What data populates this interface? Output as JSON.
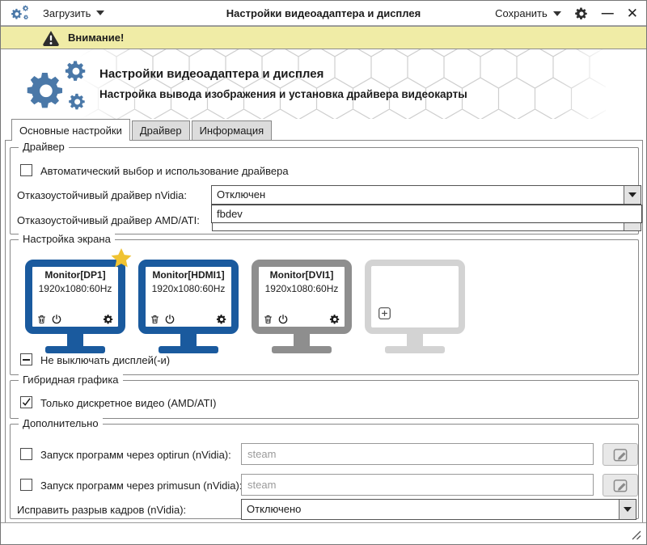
{
  "titlebar": {
    "load_label": "Загрузить",
    "title": "Настройки видеоадаптера и дисплея",
    "save_label": "Сохранить"
  },
  "banner": {
    "text": "Внимание!"
  },
  "header": {
    "title": "Настройки видеоадаптера и дисплея",
    "subtitle": "Настройка вывода изображения и установка драйвера видеокарты"
  },
  "tabs": [
    {
      "label": "Основные настройки",
      "active": true
    },
    {
      "label": "Драйвер",
      "active": false
    },
    {
      "label": "Информация",
      "active": false
    }
  ],
  "driver_group": {
    "title": "Драйвер",
    "auto_checkbox_label": "Автоматический выбор и использование драйвера",
    "auto_checkbox_checked": false,
    "nvidia_label": "Отказоустойчивый драйвер nVidia:",
    "nvidia_value": "Отключен",
    "dropdown_open_item": "fbdev",
    "amd_label": "Отказоустойчивый драйвер AMD/ATI:"
  },
  "screen_group": {
    "title": "Настройка экрана",
    "monitors": [
      {
        "name": "Monitor[DP1]",
        "resolution": "1920x1080:60Hz",
        "color": "#1a5a9e",
        "starred": true
      },
      {
        "name": "Monitor[HDMI1]",
        "resolution": "1920x1080:60Hz",
        "color": "#1a5a9e",
        "starred": false
      },
      {
        "name": "Monitor[DVI1]",
        "resolution": "1920x1080:60Hz",
        "color": "#8e8e8e",
        "starred": false
      },
      {
        "name": "",
        "resolution": "",
        "color": "#d3d3d3",
        "empty": true
      }
    ],
    "keep_on_label": "Не выключать дисплей(-и)",
    "keep_on_state": "indeterminate"
  },
  "hybrid_group": {
    "title": "Гибридная графика",
    "discrete_label": "Только дискретное видео (AMD/ATI)",
    "discrete_checked": true
  },
  "extra_group": {
    "title": "Дополнительно",
    "optirun_label": "Запуск программ через optirun (nVidia):",
    "optirun_placeholder": "steam",
    "optirun_checked": false,
    "primusun_label": "Запуск программ через primusun (nVidia):",
    "primusun_placeholder": "steam",
    "primusun_checked": false,
    "tearfree_label": "Исправить разрыв кадров (nVidia):",
    "tearfree_value": "Отключено"
  },
  "colors": {
    "accent_blue": "#4a78a8",
    "monitor_blue": "#1a5a9e",
    "monitor_gray": "#8e8e8e",
    "monitor_empty": "#d3d3d3",
    "star_gold": "#f0c332",
    "banner_yellow": "#f0eca6"
  }
}
